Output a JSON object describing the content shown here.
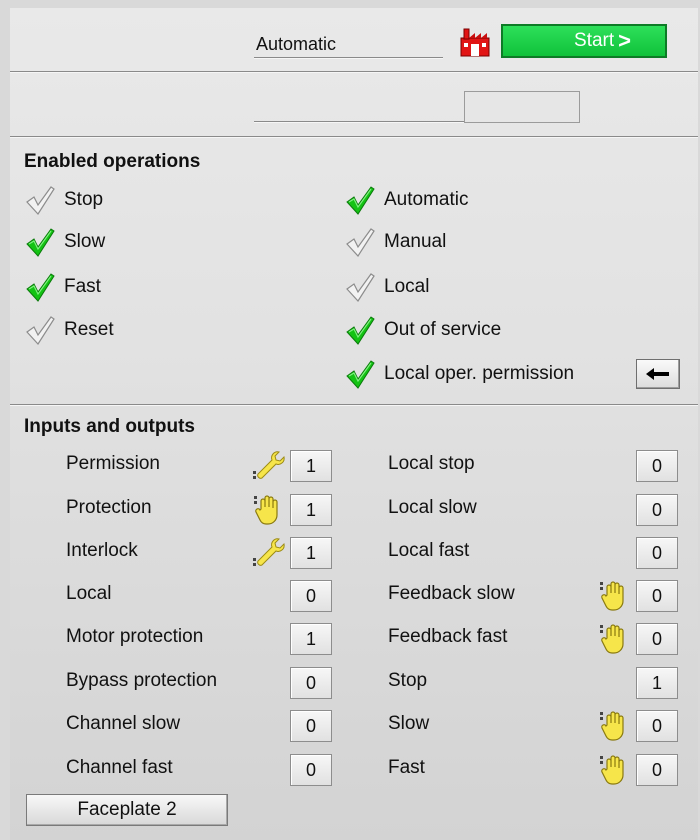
{
  "header": {
    "mode": "Automatic",
    "start_label": "Start",
    "start_arrow": ">",
    "factory_icon": "factory-icon",
    "start_color": "#1fd14b"
  },
  "enabled_operations": {
    "title": "Enabled operations",
    "left": [
      {
        "label": "Stop",
        "enabled": false
      },
      {
        "label": "Slow",
        "enabled": true
      },
      {
        "label": "Fast",
        "enabled": true
      },
      {
        "label": "Reset",
        "enabled": false
      }
    ],
    "right": [
      {
        "label": "Automatic",
        "enabled": true
      },
      {
        "label": "Manual",
        "enabled": false
      },
      {
        "label": "Local",
        "enabled": false
      },
      {
        "label": "Out of service",
        "enabled": true
      },
      {
        "label": "Local oper. permission",
        "enabled": true
      }
    ],
    "permission_button_icon": "arrow-left-icon"
  },
  "inputs_outputs": {
    "title": "Inputs and outputs",
    "left": [
      {
        "label": "Permission",
        "value": "1",
        "icon": "wrench-icon"
      },
      {
        "label": "Protection",
        "value": "1",
        "icon": "hand-icon"
      },
      {
        "label": "Interlock",
        "value": "1",
        "icon": "wrench-icon"
      },
      {
        "label": "Local",
        "value": "0",
        "icon": ""
      },
      {
        "label": "Motor protection",
        "value": "1",
        "icon": ""
      },
      {
        "label": "Bypass protection",
        "value": "0",
        "icon": ""
      },
      {
        "label": "Channel slow",
        "value": "0",
        "icon": ""
      },
      {
        "label": "Channel fast",
        "value": "0",
        "icon": ""
      }
    ],
    "right": [
      {
        "label": "Local stop",
        "value": "0",
        "icon": ""
      },
      {
        "label": "Local slow",
        "value": "0",
        "icon": ""
      },
      {
        "label": "Local fast",
        "value": "0",
        "icon": ""
      },
      {
        "label": "Feedback slow",
        "value": "0",
        "icon": "hand-icon"
      },
      {
        "label": "Feedback fast",
        "value": "0",
        "icon": "hand-icon"
      },
      {
        "label": "Stop",
        "value": "1",
        "icon": ""
      },
      {
        "label": "Slow",
        "value": "0",
        "icon": "hand-icon"
      },
      {
        "label": "Fast",
        "value": "0",
        "icon": "hand-icon"
      }
    ]
  },
  "footer": {
    "faceplate_label": "Faceplate 2"
  }
}
